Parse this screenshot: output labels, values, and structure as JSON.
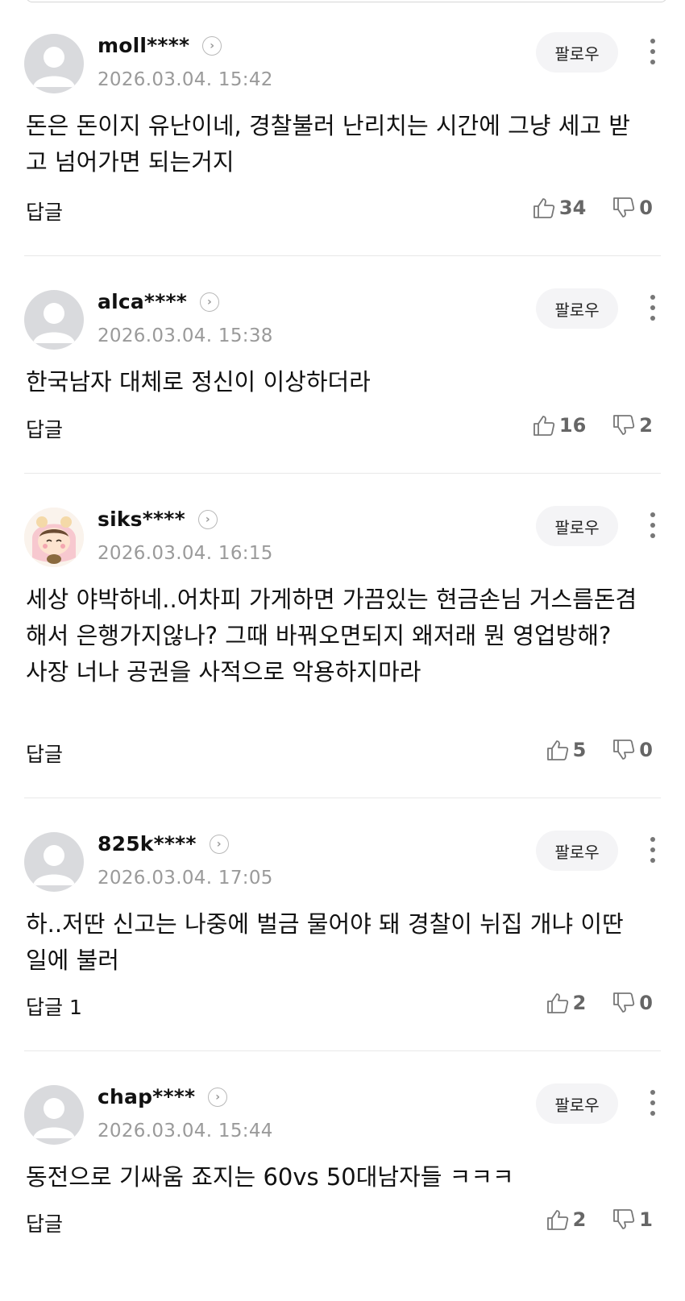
{
  "comments": [
    {
      "username": "moll****",
      "timestamp": "2026.03.04. 15:42",
      "follow_label": "팔로우",
      "content": "돈은 돈이지 유난이네, 경찰불러 난리치는 시간에 그냥 세고 받고 넘어가면 되는거지",
      "reply_label": "답글",
      "likes": "34",
      "dislikes": "0",
      "avatar": "default-avatar"
    },
    {
      "username": "alca****",
      "timestamp": "2026.03.04. 15:38",
      "follow_label": "팔로우",
      "content": "한국남자 대체로 정신이 이상하더라",
      "reply_label": "답글",
      "likes": "16",
      "dislikes": "2",
      "avatar": "default-avatar"
    },
    {
      "username": "siks****",
      "timestamp": "2026.03.04. 16:15",
      "follow_label": "팔로우",
      "content": "세상 야박하네..어차피 가게하면 가끔있는 현금손님 거스름돈겸 해서 은행가지않나? 그때 바꿔오면되지 왜저래 뭔 영업방해? 사장 너나 공권을 사적으로 악용하지마라",
      "reply_label": "답글",
      "likes": "5",
      "dislikes": "0",
      "avatar": "character-avatar"
    },
    {
      "username": "825k****",
      "timestamp": "2026.03.04. 17:05",
      "follow_label": "팔로우",
      "content": "하..저딴 신고는 나중에 벌금 물어야 돼 경찰이 뉘집 개냐 이딴 일에 불러",
      "reply_label": "답글 1",
      "likes": "2",
      "dislikes": "0",
      "avatar": "default-avatar"
    },
    {
      "username": "chap****",
      "timestamp": "2026.03.04. 15:44",
      "follow_label": "팔로우",
      "content": "동전으로 기싸움 죠지는 60vs 50대남자들 ㅋㅋㅋ",
      "reply_label": "답글",
      "likes": "2",
      "dislikes": "1",
      "avatar": "default-avatar"
    }
  ],
  "icons": {
    "like": "thumbs-up-icon",
    "dislike": "thumbs-down-icon",
    "more": "more-vertical-icon",
    "profile_link": "chevron-right-circle-icon"
  },
  "colors": {
    "text": "#111111",
    "meta": "#9a9a9a",
    "vote": "#666666",
    "follow_bg": "#f4f4f6",
    "divider": "#e8e8e8"
  }
}
